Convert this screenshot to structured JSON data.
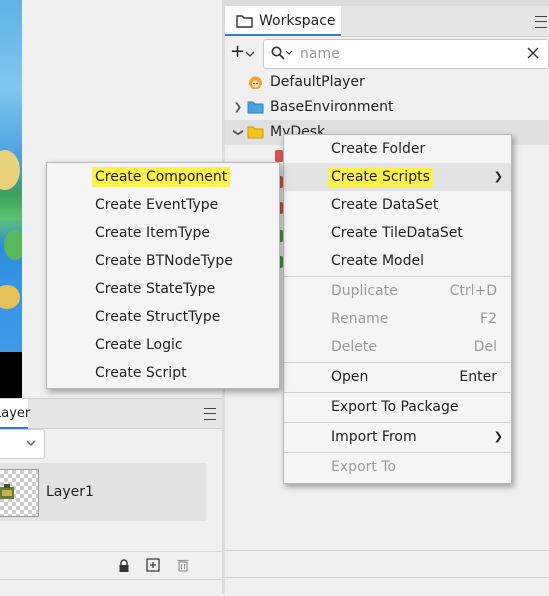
{
  "layer_panel": {
    "tab_label": "Layer",
    "layer_name": "Layer1"
  },
  "workspace": {
    "tab_label": "Workspace",
    "add_label": "+",
    "search_placeholder": "name",
    "tree": [
      {
        "label": "DefaultPlayer",
        "icon": "player-icon",
        "expandable": false
      },
      {
        "label": "BaseEnvironment",
        "icon": "folder-blue-icon",
        "expandable": true,
        "expanded": false
      },
      {
        "label": "MyDesk",
        "icon": "folder-yellow-icon",
        "expandable": true,
        "expanded": true
      }
    ]
  },
  "context_menu": {
    "items": [
      {
        "label": "Create Folder",
        "shortcut": "",
        "disabled": false
      },
      {
        "label": "Create Scripts",
        "shortcut": "",
        "disabled": false,
        "submenu": true
      },
      {
        "label": "Create DataSet",
        "shortcut": "",
        "disabled": false
      },
      {
        "label": "Create TileDataSet",
        "shortcut": "",
        "disabled": false
      },
      {
        "label": "Create Model",
        "shortcut": "",
        "disabled": false
      },
      {
        "label": "Duplicate",
        "shortcut": "Ctrl+D",
        "disabled": true
      },
      {
        "label": "Rename",
        "shortcut": "F2",
        "disabled": true
      },
      {
        "label": "Delete",
        "shortcut": "Del",
        "disabled": true
      },
      {
        "label": "Open",
        "shortcut": "Enter",
        "disabled": false
      },
      {
        "label": "Export To Package",
        "shortcut": "",
        "disabled": false
      },
      {
        "label": "Import From",
        "shortcut": "",
        "disabled": false,
        "submenu": true
      },
      {
        "label": "Export To",
        "shortcut": "",
        "disabled": true
      }
    ]
  },
  "scripts_submenu": {
    "items": [
      {
        "label": "Create Component"
      },
      {
        "label": "Create EventType"
      },
      {
        "label": "Create ItemType"
      },
      {
        "label": "Create BTNodeType"
      },
      {
        "label": "Create StateType"
      },
      {
        "label": "Create StructType"
      },
      {
        "label": "Create Logic"
      },
      {
        "label": "Create Script"
      }
    ]
  },
  "colors": {
    "highlight": "#fbf24a",
    "tab_accent": "#3a7bd5",
    "folder_blue": "#4aa3df",
    "folder_yellow": "#f2c31b"
  }
}
